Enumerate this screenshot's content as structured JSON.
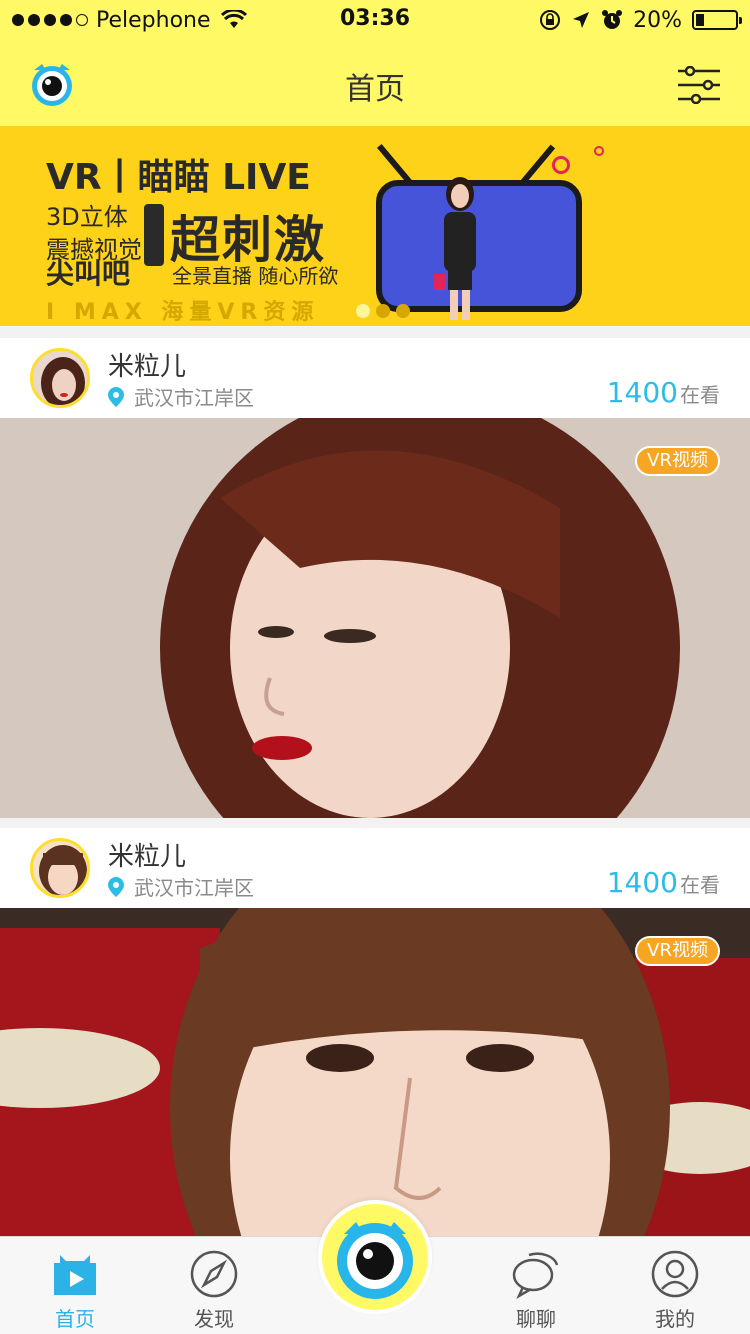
{
  "status_bar": {
    "carrier": "Pelephone",
    "time": "03:36",
    "battery": "20%",
    "battery_level": 0.2
  },
  "navbar": {
    "title": "首页"
  },
  "banner": {
    "line1": "VR丨瞄瞄 LIVE",
    "line2a": "3D立体",
    "line2b": "震撼视觉",
    "line3": "尖叫吧",
    "headline": "超刺激",
    "subtitle": "全景直播 随心所欲",
    "footer": "I MAX 海量VR资源",
    "active_page": 1,
    "page_count": 3
  },
  "feed": [
    {
      "name": "米粒儿",
      "location": "武汉市江岸区",
      "viewer_count": "1400",
      "viewer_suffix": "在看",
      "tag": "VR视频"
    },
    {
      "name": "米粒儿",
      "location": "武汉市江岸区",
      "viewer_count": "1400",
      "viewer_suffix": "在看",
      "tag": "VR视频"
    }
  ],
  "tabbar": {
    "items": [
      {
        "label": "首页",
        "icon": "tv-play-icon",
        "active": true
      },
      {
        "label": "发现",
        "icon": "compass-icon",
        "active": false
      },
      {
        "label": "聊聊",
        "icon": "chat-bubble-icon",
        "active": false
      },
      {
        "label": "我的",
        "icon": "user-icon",
        "active": false
      }
    ]
  },
  "colors": {
    "brand_yellow": "#fff965",
    "accent_blue": "#2cbde6",
    "tag_orange": "#f6a623"
  }
}
